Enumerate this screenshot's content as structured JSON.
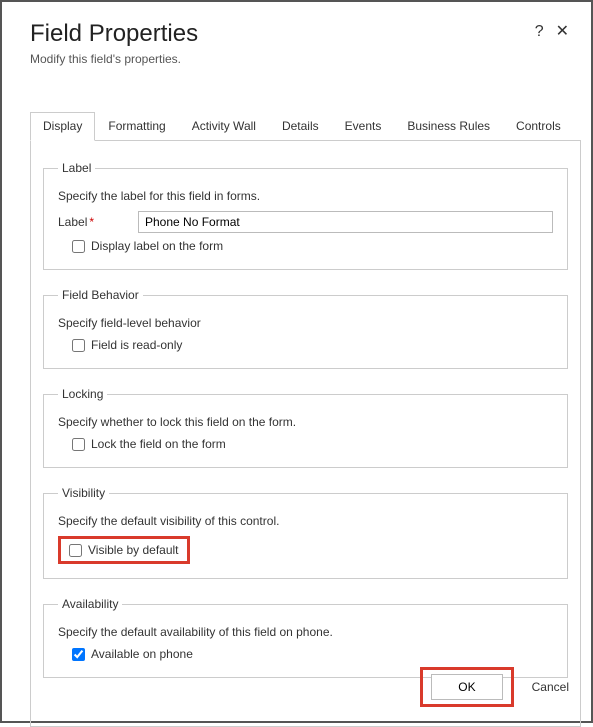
{
  "header": {
    "title": "Field Properties",
    "subtitle": "Modify this field's properties."
  },
  "tabs": [
    {
      "label": "Display"
    },
    {
      "label": "Formatting"
    },
    {
      "label": "Activity Wall"
    },
    {
      "label": "Details"
    },
    {
      "label": "Events"
    },
    {
      "label": "Business Rules"
    },
    {
      "label": "Controls"
    }
  ],
  "sections": {
    "label": {
      "legend": "Label",
      "help": "Specify the label for this field in forms.",
      "field_label": "Label",
      "value": "Phone No Format",
      "display_label_text": "Display label on the form",
      "display_label_checked": false
    },
    "behavior": {
      "legend": "Field Behavior",
      "help": "Specify field-level behavior",
      "readonly_text": "Field is read-only",
      "readonly_checked": false
    },
    "locking": {
      "legend": "Locking",
      "help": "Specify whether to lock this field on the form.",
      "lock_text": "Lock the field on the form",
      "lock_checked": false
    },
    "visibility": {
      "legend": "Visibility",
      "help": "Specify the default visibility of this control.",
      "visible_text": "Visible by default",
      "visible_checked": false
    },
    "availability": {
      "legend": "Availability",
      "help": "Specify the default availability of this field on phone.",
      "available_text": "Available on phone",
      "available_checked": true
    }
  },
  "footer": {
    "ok": "OK",
    "cancel": "Cancel"
  },
  "icons": {
    "help": "?",
    "close": "✕"
  }
}
